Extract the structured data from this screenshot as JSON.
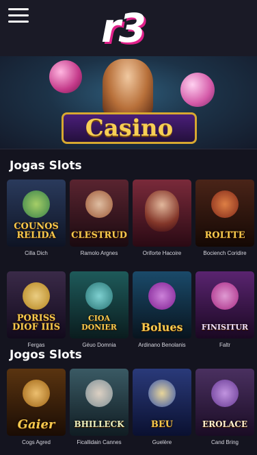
{
  "header": {
    "logo": "r3",
    "menu_icon": "hamburger-menu-icon"
  },
  "hero": {
    "banner_text": "Casino"
  },
  "sections": [
    {
      "title": "Jogas Slots",
      "games": [
        {
          "thumb_title": "COUNOS RELIDA",
          "caption": "Cilla Dich",
          "bg": "#2a3a5c",
          "accent": "#58b85a"
        },
        {
          "thumb_title": "CLESTRUD",
          "caption": "Ramolo Argnes",
          "bg": "#3b1a24",
          "accent": "#c98b5a"
        },
        {
          "thumb_title": "",
          "caption": "Oriforte Hacoire",
          "bg": "#4a1c2c",
          "accent": "#b5533a"
        },
        {
          "thumb_title": "ROLTTE",
          "caption": "Bociench Coridire",
          "bg": "#2a1a12",
          "accent": "#c44a2a"
        },
        {
          "thumb_title": "PORISS DIOF IIIS",
          "caption": "Fergas",
          "bg": "#2a1e3a",
          "accent": "#d8a830"
        },
        {
          "thumb_title": "CIOA DONIER",
          "caption": "Géuo Domnia",
          "bg": "#153a40",
          "accent": "#3a8a8a"
        },
        {
          "thumb_title": "Bolues",
          "caption": "Ardinano Benolanis",
          "bg": "#123448",
          "accent": "#9a2aa8"
        },
        {
          "thumb_title": "FINISITUR",
          "caption": "Faltr",
          "bg": "#3a1848",
          "accent": "#c43a9a"
        }
      ]
    },
    {
      "title": "Jogos Slots",
      "games": [
        {
          "thumb_title": "Gaier",
          "caption": "Cogs Agred",
          "bg": "#3a2410",
          "accent": "#d89a2a"
        },
        {
          "thumb_title": "BHILLECK",
          "caption": "Ficallidain Cannes",
          "bg": "#2e4048",
          "accent": "#a8c8c8"
        },
        {
          "thumb_title": "BEU",
          "caption": "Guelère",
          "bg": "#1e2a5c",
          "accent": "#e0c040"
        },
        {
          "thumb_title": "EROLACE",
          "caption": "Cand Bring",
          "bg": "#3a2448",
          "accent": "#8a5aa8"
        }
      ]
    }
  ]
}
